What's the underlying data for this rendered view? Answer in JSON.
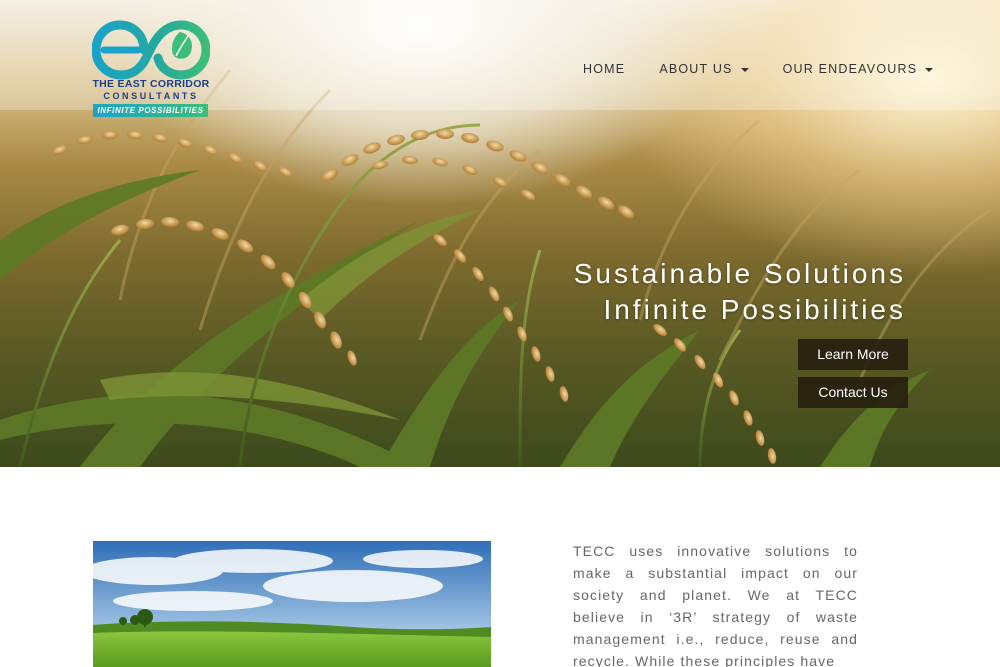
{
  "brand": {
    "name": "THE EAST CORRIDOR",
    "sub": "CONSULTANTS",
    "tagline": "INFINITE POSSIBILITIES"
  },
  "nav": {
    "home": "HOME",
    "about": "ABOUT US",
    "endeavours": "OUR ENDEAVOURS"
  },
  "hero": {
    "line1": "Sustainable Solutions",
    "line2": "Infinite Possibilities",
    "learn_more": "Learn More",
    "contact_us": "Contact Us"
  },
  "intro": {
    "text": "TECC uses innovative solutions to make a substantial impact on our society and planet. We at TECC believe in ‘3R’ strategy of waste management i.e., reduce, reuse and recycle. While these principles have"
  },
  "colors": {
    "logo_blue": "#1b3f8b",
    "logo_teal": "#1aa3c9",
    "logo_green": "#3dbd7a",
    "button_bg": "#261c0e"
  }
}
